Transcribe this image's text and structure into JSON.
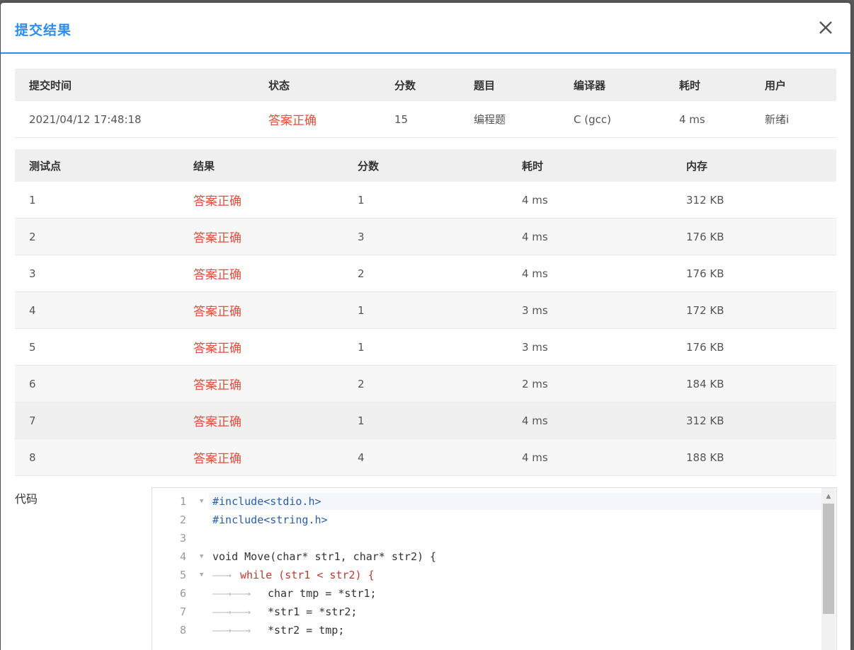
{
  "dialog": {
    "title": "提交结果",
    "close_label": "×"
  },
  "summary": {
    "headers": [
      "提交时间",
      "状态",
      "分数",
      "题目",
      "编译器",
      "耗时",
      "用户"
    ],
    "row": [
      "2021/04/12 17:48:18",
      "答案正确",
      "15",
      "编程题",
      "C (gcc)",
      "4 ms",
      "新绪i"
    ]
  },
  "tests": {
    "headers": [
      "测试点",
      "结果",
      "分数",
      "耗时",
      "内存"
    ],
    "rows": [
      [
        "1",
        "答案正确",
        "1",
        "4 ms",
        "312 KB"
      ],
      [
        "2",
        "答案正确",
        "3",
        "4 ms",
        "176 KB"
      ],
      [
        "3",
        "答案正确",
        "2",
        "4 ms",
        "176 KB"
      ],
      [
        "4",
        "答案正确",
        "1",
        "3 ms",
        "172 KB"
      ],
      [
        "5",
        "答案正确",
        "1",
        "3 ms",
        "176 KB"
      ],
      [
        "6",
        "答案正确",
        "2",
        "2 ms",
        "184 KB"
      ],
      [
        "7",
        "答案正确",
        "1",
        "4 ms",
        "312 KB"
      ],
      [
        "8",
        "答案正确",
        "4",
        "4 ms",
        "188 KB"
      ]
    ]
  },
  "code": {
    "label": "代码",
    "line_numbers": [
      "1",
      "2",
      "3",
      "4",
      "5",
      "6",
      "7",
      "8"
    ],
    "lines": [
      "#include<stdio.h>",
      "#include<string.h>",
      "",
      "void Move(char* str1, char* str2) {",
      "while (str1 < str2) {",
      "char tmp = *str1;",
      "*str1 = *str2;",
      "*str2 = tmp;"
    ]
  },
  "colors": {
    "accent": "#2d8cf0",
    "success_text": "#e74c3c"
  }
}
